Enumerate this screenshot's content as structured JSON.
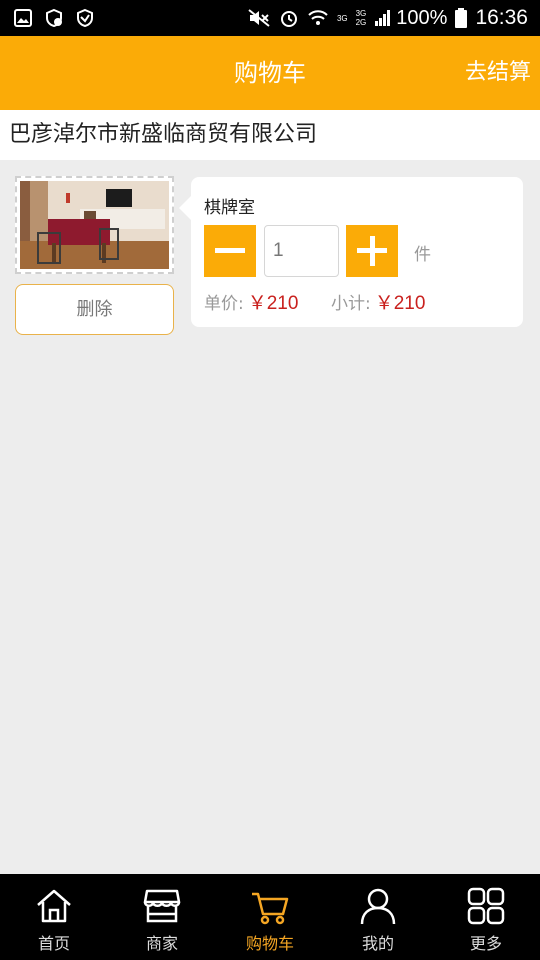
{
  "status_bar": {
    "network_top": "3G",
    "network_mid": "3G",
    "network_bottom": "2G",
    "battery": "100%",
    "time": "16:36"
  },
  "header": {
    "title": "购物车",
    "checkout_label": "去结算"
  },
  "shop": {
    "name": "巴彦淖尔市新盛临商贸有限公司"
  },
  "cart_item": {
    "name": "棋牌室",
    "quantity": "1",
    "unit": "件",
    "unit_price_label": "单价:",
    "unit_price": "￥210",
    "subtotal_label": "小计:",
    "subtotal": "￥210",
    "delete_label": "删除"
  },
  "bottom_nav": {
    "items": [
      {
        "label": "首页",
        "icon": "home-icon"
      },
      {
        "label": "商家",
        "icon": "shop-icon"
      },
      {
        "label": "购物车",
        "icon": "cart-icon",
        "active": true
      },
      {
        "label": "我的",
        "icon": "user-icon"
      },
      {
        "label": "更多",
        "icon": "grid-icon"
      }
    ]
  },
  "colors": {
    "accent": "#fbab07",
    "price": "#c9211e",
    "nav_active": "#f5a623"
  }
}
